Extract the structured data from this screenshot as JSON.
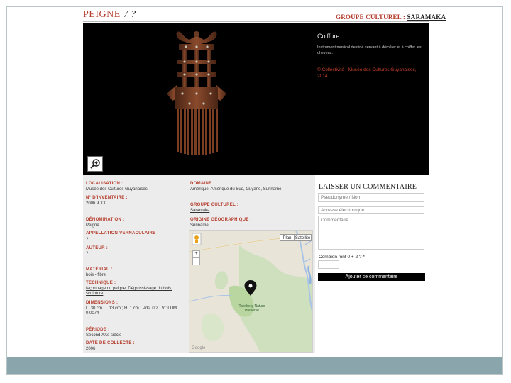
{
  "header": {
    "title": "PEIGNE",
    "subtitle": "/ ?",
    "group_label": "GROUPE CULTUREL :",
    "group_value": "SARAMAKA"
  },
  "info_panel": {
    "category": "Coiffure",
    "description": "Instrument musical destiné servant à démêler et à coiffer les cheveux.",
    "credit": "© Collectivité - Musée des Cultures Guyanaises, 2014"
  },
  "fields_left": [
    {
      "label": "LOCALISATION :",
      "value": "Musée des Cultures Guyanaises"
    },
    {
      "label": "N° D'INVENTAIRE :",
      "value": "2006.9.XX"
    },
    {
      "label": "DÉNOMINATION :",
      "value": "Peigne"
    },
    {
      "label": "APPELLATION VERNACULAIRE :",
      "value": "?"
    },
    {
      "label": "AUTEUR :",
      "value": "?"
    },
    {
      "label": "MATÉRIAU :",
      "value": "bois - fibre"
    },
    {
      "label": "TECHNIQUE :",
      "value": "façonnage du peigne, Dégrossissage du bois, sculpture"
    },
    {
      "label": "DIMENSIONS :",
      "value": "L. 30 cm ; l. 13 cm ; H. 1 cm ; Pds. 0,2 ; VOLUM. 0,0074"
    },
    {
      "label": "PÉRIODE :",
      "value": "Second XXe siècle"
    },
    {
      "label": "DATE DE COLLECTE :",
      "value": "2006"
    }
  ],
  "fields_right": [
    {
      "label": "DOMAINE :",
      "value": "Amérique, Amérique du Sud, Guyane, Suriname"
    },
    {
      "label": "GROUPE CULTUREL :",
      "value": "Saramaka"
    },
    {
      "label": "ORIGINE GÉOGRAPHIQUE :",
      "value": "Suriname"
    }
  ],
  "map": {
    "plan_label": "Plan",
    "satellite_label": "Satellite",
    "place_name": "Tafelberg Nature Preserve",
    "watermark": "Google"
  },
  "comment": {
    "heading": "LAISSER UN COMMENTAIRE",
    "pseudonym_placeholder": "Pseudonyme / Nom",
    "email_placeholder": "Adresse électronique",
    "comment_placeholder": "Commentaire",
    "captcha_label": "Combien font 0 + 2 ? *",
    "submit_label": "Ajouter ce commentaire"
  },
  "colors": {
    "accent_red": "#b43c2c",
    "panel_bg": "#000000",
    "field_bg": "#ececec",
    "footer_bar": "#8aa5ab"
  }
}
